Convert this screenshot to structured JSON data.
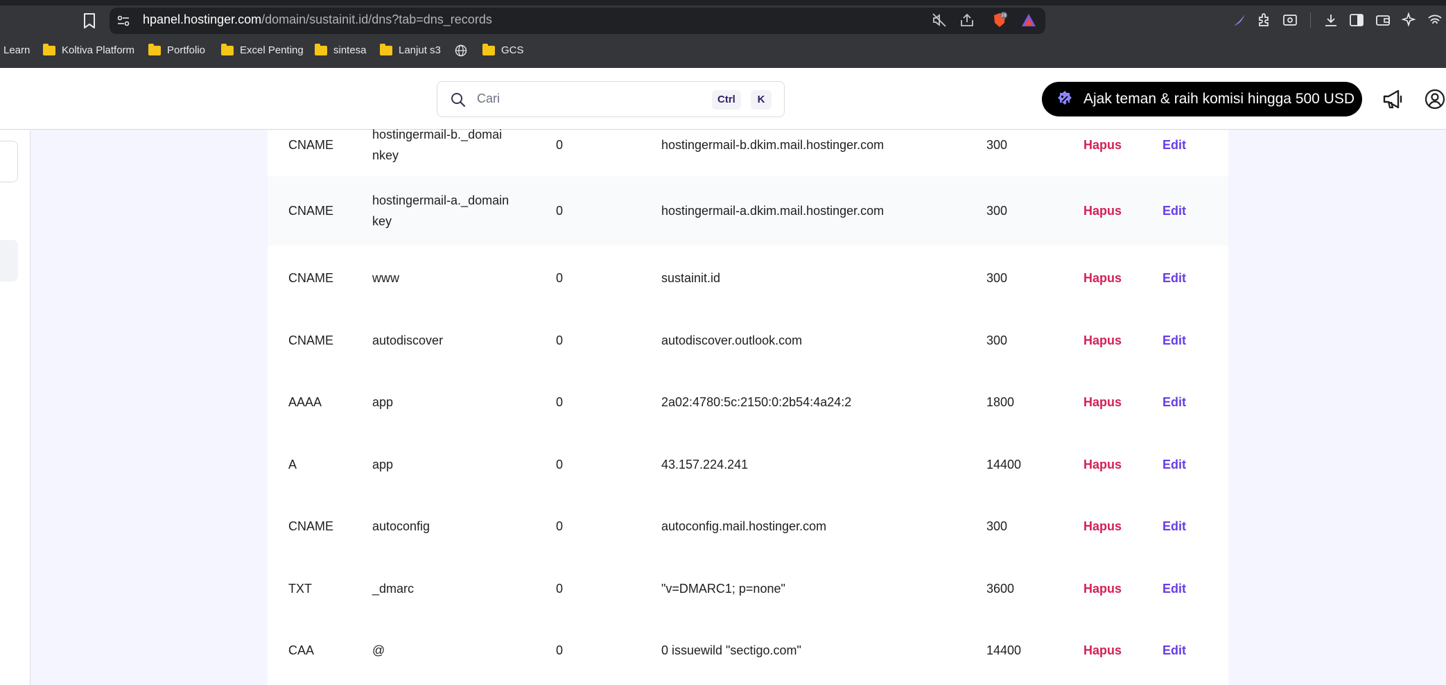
{
  "browser": {
    "url_host": "hpanel.hostinger.com",
    "url_path": "/domain/sustainit.id/dns?tab=dns_records",
    "brave_badge_count": "28",
    "bookmarks": [
      {
        "label": "Learn",
        "icon": "none"
      },
      {
        "label": "Koltiva Platform",
        "icon": "folder-icon"
      },
      {
        "label": "Portfolio",
        "icon": "folder-icon"
      },
      {
        "label": "Excel Penting",
        "icon": "folder-icon"
      },
      {
        "label": "sintesa",
        "icon": "folder-icon"
      },
      {
        "label": "Lanjut s3",
        "icon": "folder-icon"
      },
      {
        "label": "",
        "icon": "globe-icon"
      },
      {
        "label": "GCS",
        "icon": "folder-icon"
      }
    ]
  },
  "header": {
    "search_placeholder": "Cari",
    "shortcut_ctrl": "Ctrl",
    "shortcut_k": "K",
    "promo_label": "Ajak teman & raih komisi hingga 500 USD"
  },
  "dns": {
    "delete_label": "Hapus",
    "edit_label": "Edit",
    "records": [
      {
        "type": "CNAME",
        "name": "hostingermail-b._domainkey",
        "name_line1": "hostingermail-b._domai",
        "name_line2": "nkey",
        "priority": "0",
        "content": "hostingermail-b.dkim.mail.hostinger.com",
        "ttl": "300"
      },
      {
        "type": "CNAME",
        "name": "hostingermail-a._domainkey",
        "name_line1": "hostingermail-a._domain",
        "name_line2": "key",
        "priority": "0",
        "content": "hostingermail-a.dkim.mail.hostinger.com",
        "ttl": "300"
      },
      {
        "type": "CNAME",
        "name": "www",
        "priority": "0",
        "content": "sustainit.id",
        "ttl": "300"
      },
      {
        "type": "CNAME",
        "name": "autodiscover",
        "priority": "0",
        "content": "autodiscover.outlook.com",
        "ttl": "300"
      },
      {
        "type": "AAAA",
        "name": "app",
        "priority": "0",
        "content": "2a02:4780:5c:2150:0:2b54:4a24:2",
        "ttl": "1800"
      },
      {
        "type": "A",
        "name": "app",
        "priority": "0",
        "content": "43.157.224.241",
        "ttl": "14400"
      },
      {
        "type": "CNAME",
        "name": "autoconfig",
        "priority": "0",
        "content": "autoconfig.mail.hostinger.com",
        "ttl": "300"
      },
      {
        "type": "TXT",
        "name": "_dmarc",
        "priority": "0",
        "content": "\"v=DMARC1; p=none\"",
        "ttl": "3600"
      },
      {
        "type": "CAA",
        "name": "@",
        "priority": "0",
        "content": "0 issuewild \"sectigo.com\"",
        "ttl": "14400"
      }
    ]
  }
}
